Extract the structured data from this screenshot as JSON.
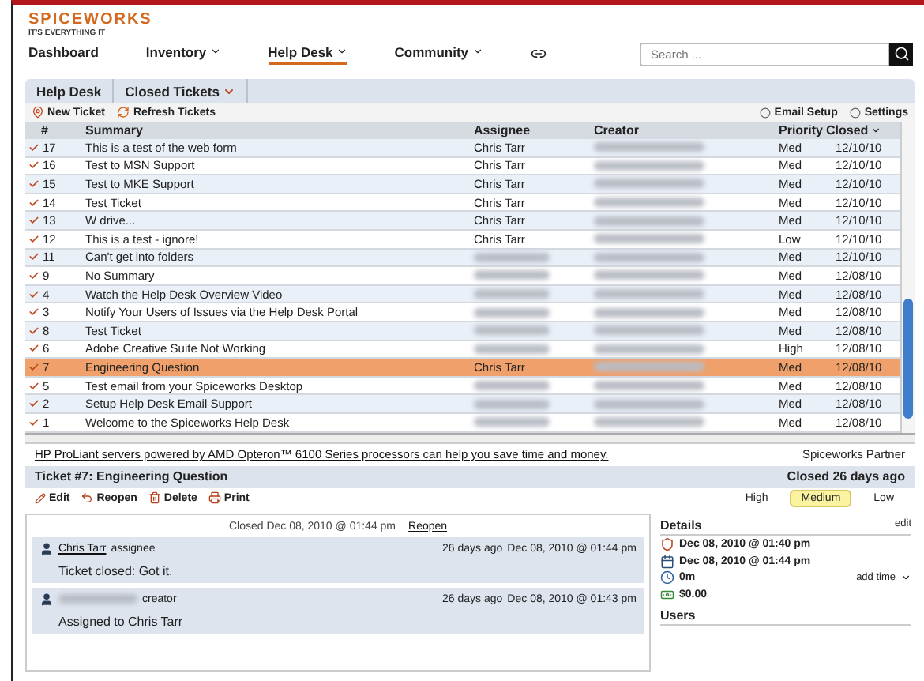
{
  "logo": {
    "name": "SPICEWORKS",
    "tagline": "IT'S EVERYTHING IT"
  },
  "nav": [
    {
      "label": "Dashboard",
      "selected": false,
      "dropdown": false
    },
    {
      "label": "Inventory",
      "selected": false,
      "dropdown": true
    },
    {
      "label": "Help Desk",
      "selected": true,
      "dropdown": true
    },
    {
      "label": "Community",
      "selected": false,
      "dropdown": true
    }
  ],
  "search": {
    "placeholder": "Search ..."
  },
  "breadcrumbs": [
    {
      "label": "Help Desk",
      "dropdown": false
    },
    {
      "label": "Closed Tickets",
      "dropdown": true
    }
  ],
  "toolbar": {
    "left": [
      {
        "kind": "new",
        "label": "New Ticket"
      },
      {
        "kind": "refresh",
        "label": "Refresh Tickets"
      }
    ],
    "right": [
      {
        "kind": "option",
        "label": "Email Setup"
      },
      {
        "kind": "option",
        "label": "Settings"
      }
    ]
  },
  "table": {
    "columns": [
      "#",
      "Summary",
      "Assignee",
      "Creator",
      "Priority",
      "Closed"
    ],
    "rows": [
      {
        "number": "17",
        "summary": "This is a test of the web form",
        "assignee": "Chris Tarr",
        "priority": "Med",
        "closed": "12/10/10",
        "selected": false
      },
      {
        "number": "16",
        "summary": "Test to MSN Support",
        "assignee": "Chris Tarr",
        "priority": "Med",
        "closed": "12/10/10",
        "selected": false
      },
      {
        "number": "15",
        "summary": "Test to MKE Support",
        "assignee": "Chris Tarr",
        "priority": "Med",
        "closed": "12/10/10",
        "selected": false
      },
      {
        "number": "14",
        "summary": "Test Ticket",
        "assignee": "Chris Tarr",
        "priority": "Med",
        "closed": "12/10/10",
        "selected": false
      },
      {
        "number": "13",
        "summary": "W drive...",
        "assignee": "Chris Tarr",
        "priority": "Med",
        "closed": "12/10/10",
        "selected": false
      },
      {
        "number": "12",
        "summary": "This is a test - ignore!",
        "assignee": "Chris Tarr",
        "priority": "Low",
        "closed": "12/10/10",
        "selected": false
      },
      {
        "number": "11",
        "summary": "Can't get into folders",
        "priority": "Med",
        "closed": "12/10/10",
        "selected": false
      },
      {
        "number": "9",
        "summary": "No Summary",
        "priority": "Med",
        "closed": "12/08/10",
        "selected": false
      },
      {
        "number": "4",
        "summary": "Watch the Help Desk Overview Video",
        "priority": "Med",
        "closed": "12/08/10",
        "selected": false
      },
      {
        "number": "3",
        "summary": "Notify Your Users of Issues via the Help Desk Portal",
        "priority": "Med",
        "closed": "12/08/10",
        "selected": false
      },
      {
        "number": "8",
        "summary": "Test Ticket",
        "priority": "Med",
        "closed": "12/08/10",
        "selected": false
      },
      {
        "number": "6",
        "summary": "Adobe Creative Suite Not Working",
        "priority": "High",
        "closed": "12/08/10",
        "selected": false
      },
      {
        "number": "7",
        "summary": "Engineering Question",
        "assignee": "Chris Tarr",
        "priority": "Med",
        "closed": "12/08/10",
        "selected": true
      },
      {
        "number": "5",
        "summary": "Test email from your Spiceworks Desktop",
        "priority": "Med",
        "closed": "12/08/10",
        "selected": false
      },
      {
        "number": "2",
        "summary": "Setup Help Desk Email Support",
        "priority": "Med",
        "closed": "12/08/10",
        "selected": false
      },
      {
        "number": "1",
        "summary": "Welcome to the Spiceworks Help Desk",
        "priority": "Med",
        "closed": "12/08/10",
        "selected": false
      }
    ]
  },
  "ad": {
    "text": "HP ProLiant servers powered by AMD Opteron™ 6100 Series processors can help you save time and money.",
    "partner": "Spiceworks Partner"
  },
  "ticket": {
    "title": "Ticket #7: Engineering Question",
    "status": "Closed 26 days ago",
    "actions": [
      {
        "kind": "edit",
        "label": "Edit"
      },
      {
        "kind": "reopen",
        "label": "Reopen"
      },
      {
        "kind": "delete",
        "label": "Delete"
      },
      {
        "kind": "print",
        "label": "Print"
      }
    ],
    "priorities": [
      {
        "label": "High",
        "selected": false
      },
      {
        "label": "Medium",
        "selected": true
      },
      {
        "label": "Low",
        "selected": false
      }
    ]
  },
  "activity": {
    "closed_line": "Closed Dec 08, 2010 @ 01:44 pm",
    "reopen": "Reopen",
    "entries": [
      {
        "author": "Chris Tarr",
        "role": "assignee",
        "ago": "26 days ago",
        "time": "Dec 08, 2010 @ 01:44 pm",
        "text": "Ticket closed: Got it."
      },
      {
        "role": "creator",
        "ago": "26 days ago",
        "time": "Dec 08, 2010 @ 01:43 pm",
        "text": "Assigned to Chris Tarr"
      }
    ]
  },
  "details": {
    "title": "Details",
    "edit": "edit",
    "items": [
      {
        "kind": "created",
        "text": "Dec 08, 2010 @ 01:40 pm"
      },
      {
        "kind": "closed",
        "text": "Dec 08, 2010 @ 01:44 pm"
      },
      {
        "kind": "time",
        "text": "0m",
        "action": "add time"
      },
      {
        "kind": "cost",
        "text": "$0.00"
      }
    ],
    "users_title": "Users"
  }
}
